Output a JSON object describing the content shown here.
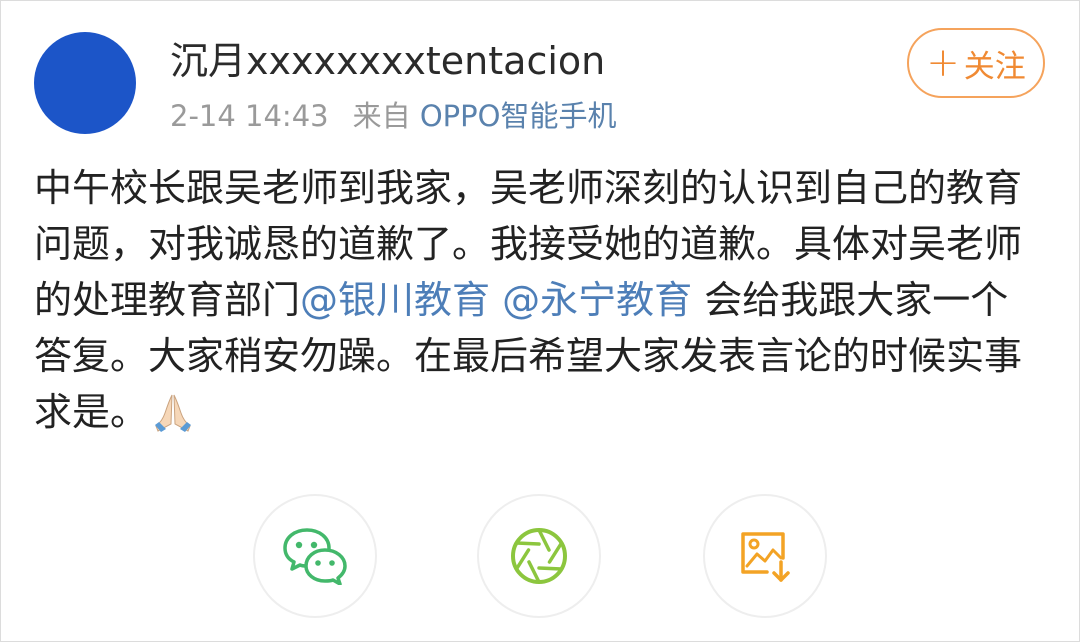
{
  "post": {
    "username": "沉月xxxxxxxxtentacion",
    "time": "2-14 14:43",
    "source_prefix": "来自",
    "source": "OPPO智能手机",
    "follow_label": "关注",
    "follow_icon": "plus-icon",
    "lines": [
      {
        "segments": [
          {
            "text": "中午校长跟吴老师到我家，吴老师深刻的认识到自己的教育",
            "mention": false
          }
        ]
      },
      {
        "segments": [
          {
            "text": "问题，对我诚恳的道歉了。我接受她的道歉。具体对吴老师",
            "mention": false
          }
        ]
      },
      {
        "segments": [
          {
            "text": "的处理教育部门",
            "mention": false
          },
          {
            "text": "@银川教育",
            "mention": true
          },
          {
            "text": " ",
            "mention": false
          },
          {
            "text": "@永宁教育",
            "mention": true
          },
          {
            "text": " 会给我跟大家一个",
            "mention": false
          }
        ]
      },
      {
        "segments": [
          {
            "text": "答复。大家稍安勿躁。在最后希望大家发表言论的时候实事",
            "mention": false
          }
        ]
      },
      {
        "segments": [
          {
            "text": "求是。",
            "mention": false
          }
        ]
      }
    ],
    "emoji": "praying-hands-emoji"
  },
  "share": [
    {
      "name": "share-wechat-button",
      "icon": "wechat-icon"
    },
    {
      "name": "share-moments-button",
      "icon": "moments-icon"
    },
    {
      "name": "share-save-image-button",
      "icon": "save-image-icon"
    }
  ],
  "colors": {
    "avatar": "#1c55c8",
    "follow": "#f08a33",
    "mention": "#4d7eb8",
    "wechat": "#43b86b",
    "moments": "#8cc63e",
    "save_image": "#f3a325"
  }
}
